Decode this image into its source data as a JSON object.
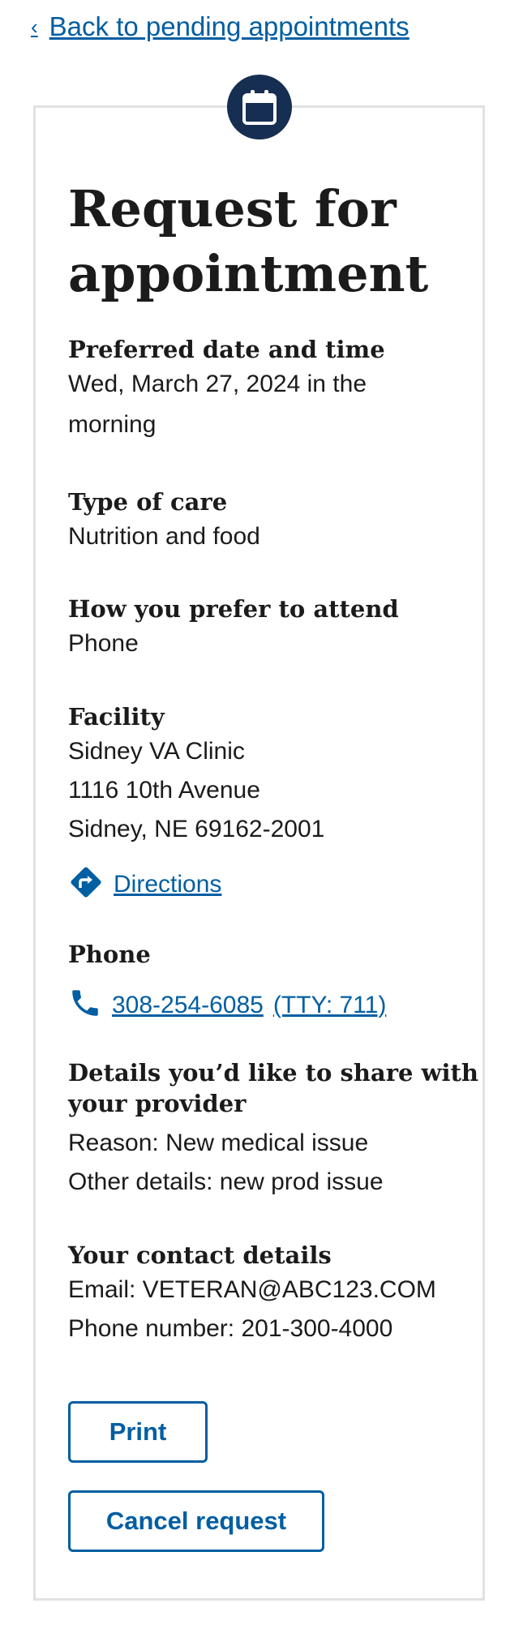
{
  "nav": {
    "back_chevron": "‹",
    "back_label": "Back to pending appointments"
  },
  "page": {
    "title": "Request for appointment",
    "icon": "calendar-icon"
  },
  "preferred": {
    "label": "Preferred date and time",
    "line1": "Wed, March 27, 2024 in the",
    "line2": "morning"
  },
  "care": {
    "label": "Type of care",
    "value": "Nutrition and food"
  },
  "attend": {
    "label": "How you prefer to attend",
    "value": "Phone"
  },
  "facility": {
    "label": "Facility",
    "name": "Sidney VA Clinic",
    "street": "1116 10th Avenue",
    "city": "Sidney, NE 69162-2001",
    "directions_label": "Directions"
  },
  "phone": {
    "label": "Phone",
    "number": "308-254-6085",
    "tty": "(TTY: 711)"
  },
  "details": {
    "label_line1": "Details you’d like to share with",
    "label_line2": "your provider",
    "reason": "Reason: New medical issue",
    "other": "Other details: new prod issue"
  },
  "contact": {
    "label": "Your contact details",
    "email": "Email: VETERAN@ABC123.COM",
    "phone": "Phone number: 201-300-4000"
  },
  "actions": {
    "print_label": "Print",
    "cancel_label": "Cancel request"
  },
  "colors": {
    "link": "#005ea2",
    "badge": "#162e51",
    "border": "#dfe1e2"
  }
}
